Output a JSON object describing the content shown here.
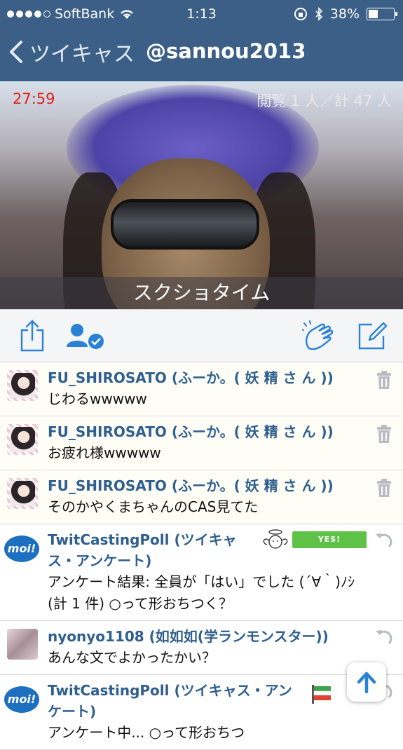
{
  "status_bar": {
    "carrier": "SoftBank",
    "time": "1:13",
    "battery_percent": "38%",
    "battery_level": 0.38
  },
  "nav": {
    "back_label": "ツイキャス",
    "title": "@sannou2013"
  },
  "video": {
    "timer": "27:59",
    "viewers": "閲覧 1 人／計 47 人",
    "caption": "スクショタイム"
  },
  "toolbar": {
    "icons": [
      "share-icon",
      "follow-user-icon",
      "clap-icon",
      "compose-icon"
    ]
  },
  "comments": [
    {
      "user": "FU_SHIROSATO (ふーか。( 妖 精 さ ん ))",
      "text": "じわるwwwww",
      "avatar": "girl",
      "action": "trash-icon"
    },
    {
      "user": "FU_SHIROSATO (ふーか。( 妖 精 さ ん ))",
      "text": "お疲れ様wwwww",
      "avatar": "girl",
      "action": "trash-icon"
    },
    {
      "user": "FU_SHIROSATO (ふーか。( 妖 精 さ ん ))",
      "text": "そのかやくまちゃんのCAS見てた",
      "avatar": "girl",
      "action": "trash-icon"
    },
    {
      "user": "TwitCastingPoll (ツイキャス・アンケート)",
      "text": "アンケート結果: 全員が「はい」でした (´∀｀)ﾉｼ (計 1 件) ○って形おちつく？",
      "avatar": "moi",
      "avatar_label": "moi!",
      "badge": "YES!",
      "action": "reply-icon"
    },
    {
      "user": "nyonyo1108 (如如如(学ランモンスター))",
      "text": "あんな文でよかったかい？",
      "avatar": "nyo",
      "action": "reply-icon"
    },
    {
      "user": "TwitCastingPoll (ツイキャス・アンケート)",
      "text": "アンケート中... ○って形おちつ",
      "avatar": "moi",
      "avatar_label": "moi!",
      "action": "reply-icon"
    }
  ],
  "colors": {
    "nav_bg": "#3b5f86",
    "accent": "#1f7fd6",
    "username": "#2f5f8f",
    "timer": "#e0201b",
    "yes_badge": "#5ec246"
  }
}
